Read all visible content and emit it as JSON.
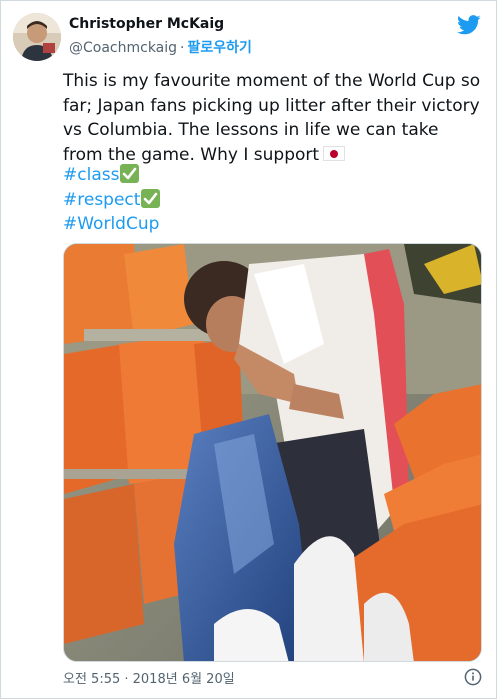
{
  "author": {
    "name": "Christopher McKaig",
    "handle": "@Coachmckaig",
    "separator": "·",
    "follow_label": "팔로우하기"
  },
  "tweet": {
    "text": "This is my favourite moment of the World Cup so far; Japan fans picking up litter after their victory vs Columbia. The lessons in life we can take from the game. Why I support",
    "hashtags": [
      "#class",
      "#respect",
      "#WorldCup"
    ]
  },
  "media": {
    "description_icon": "photo-media"
  },
  "footer": {
    "timestamp": "오전 5:55 · 2018년 6월 20일"
  },
  "colors": {
    "accent": "#1d9bf0",
    "text": "#0f1419",
    "muted": "#536471",
    "check_green": "#77b255",
    "flag_red": "#bc002d"
  },
  "icons": {
    "brand": "twitter-bird-icon",
    "info": "info-icon",
    "check": "check-mark-icon",
    "flag": "japan-flag-icon"
  }
}
